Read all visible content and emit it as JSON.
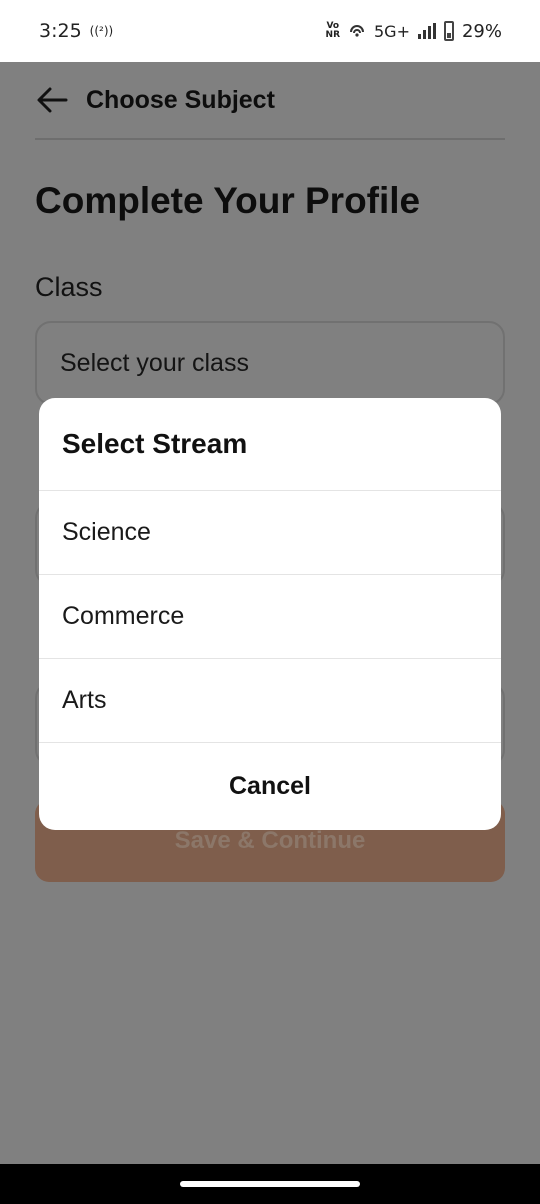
{
  "status_bar": {
    "time": "3:25",
    "hotspot_icon_text": "((²))",
    "vonr_top": "Vo",
    "vonr_bottom": "NR",
    "network": "5G+",
    "battery": "29%"
  },
  "header": {
    "back_icon": "arrow-left-icon",
    "title": "Choose Subject"
  },
  "page": {
    "title": "Complete Your Profile",
    "class_label": "Class",
    "class_placeholder": "Select your class",
    "save_label": "Save & Continue"
  },
  "dialog": {
    "title": "Select Stream",
    "options": [
      "Science",
      "Commerce",
      "Arts"
    ],
    "cancel_label": "Cancel"
  },
  "colors": {
    "scrim": "#808080",
    "button": "#7f5e4c",
    "dialog_bg": "#ffffff"
  }
}
